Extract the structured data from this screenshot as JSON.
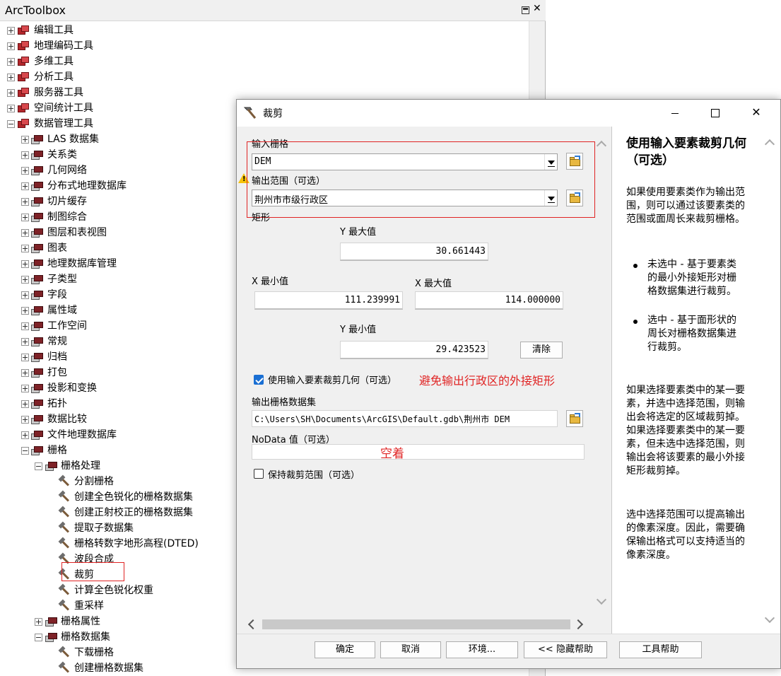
{
  "toolbox": {
    "title": "ArcToolbox",
    "items": [
      {
        "label": "编辑工具"
      },
      {
        "label": "地理编码工具"
      },
      {
        "label": "多维工具"
      },
      {
        "label": "分析工具"
      },
      {
        "label": "服务器工具"
      },
      {
        "label": "空间统计工具"
      },
      {
        "label": "数据管理工具"
      },
      {
        "label": "LAS 数据集"
      },
      {
        "label": "关系类"
      },
      {
        "label": "几何网络"
      },
      {
        "label": "分布式地理数据库"
      },
      {
        "label": "切片缓存"
      },
      {
        "label": "制图综合"
      },
      {
        "label": "图层和表视图"
      },
      {
        "label": "图表"
      },
      {
        "label": "地理数据库管理"
      },
      {
        "label": "子类型"
      },
      {
        "label": "字段"
      },
      {
        "label": "属性域"
      },
      {
        "label": "工作空间"
      },
      {
        "label": "常规"
      },
      {
        "label": "归档"
      },
      {
        "label": "打包"
      },
      {
        "label": "投影和变换"
      },
      {
        "label": "拓扑"
      },
      {
        "label": "数据比较"
      },
      {
        "label": "文件地理数据库"
      },
      {
        "label": "栅格"
      },
      {
        "label": "栅格处理"
      },
      {
        "label": "分割栅格"
      },
      {
        "label": "创建全色锐化的栅格数据集"
      },
      {
        "label": "创建正射校正的栅格数据集"
      },
      {
        "label": "提取子数据集"
      },
      {
        "label": "栅格转数字地形高程(DTED)"
      },
      {
        "label": "波段合成"
      },
      {
        "label": "裁剪"
      },
      {
        "label": "计算全色锐化权重"
      },
      {
        "label": "重采样"
      },
      {
        "label": "栅格属性"
      },
      {
        "label": "栅格数据集"
      },
      {
        "label": "下载栅格"
      },
      {
        "label": "创建栅格数据集"
      }
    ]
  },
  "dialog": {
    "title": "裁剪",
    "controls": {
      "minimize": "—",
      "maximize": "☐",
      "close": "✕"
    },
    "input_raster": {
      "label": "输入栅格",
      "value": "DEM"
    },
    "output_extent": {
      "label": "输出范围（可选）",
      "value": "荆州市市级行政区"
    },
    "rectangle": {
      "label": "矩形",
      "y_max_label": "Y 最大值",
      "y_max": "30.661443",
      "x_min_label": "X 最小值",
      "x_min": "111.239991",
      "x_max_label": "X 最大值",
      "x_max": "114.000000",
      "y_min_label": "Y 最小值",
      "y_min": "29.423523",
      "clear_label": "清除"
    },
    "use_geometry": {
      "label": "使用输入要素裁剪几何（可选）",
      "checked": true
    },
    "annotation_geometry": "避免输出行政区的外接矩形",
    "output_raster": {
      "label": "输出栅格数据集",
      "value": "C:\\Users\\SH\\Documents\\ArcGIS\\Default.gdb\\荆州市 DEM"
    },
    "nodata": {
      "label": "NoData 值（可选）",
      "value": ""
    },
    "annotation_nodata": "空着",
    "maintain_extent": {
      "label": "保持裁剪范围（可选）",
      "checked": false
    },
    "buttons": {
      "ok": "确定",
      "cancel": "取消",
      "env": "环境...",
      "hide_help": "<< 隐藏帮助",
      "tool_help": "工具帮助"
    }
  },
  "help": {
    "title": "使用输入要素裁剪几何（可选）",
    "p1": "如果使用要素类作为输出范围，则可以通过该要素类的范围或面周长来裁剪栅格。",
    "bullet1": "未选中 - 基于要素类的最小外接矩形对栅格数据集进行裁剪。",
    "bullet2": "选中 - 基于面形状的周长对栅格数据集进行裁剪。",
    "p2": "如果选择要素类中的某一要素，并选中选择范围，则输出会将选定的区域裁剪掉。如果选择要素类中的某一要素，但未选中选择范围，则输出会将该要素的最小外接矩形裁剪掉。",
    "p3": "选中选择范围可以提高输出的像素深度。因此，需要确保输出格式可以支持适当的像素深度。"
  }
}
